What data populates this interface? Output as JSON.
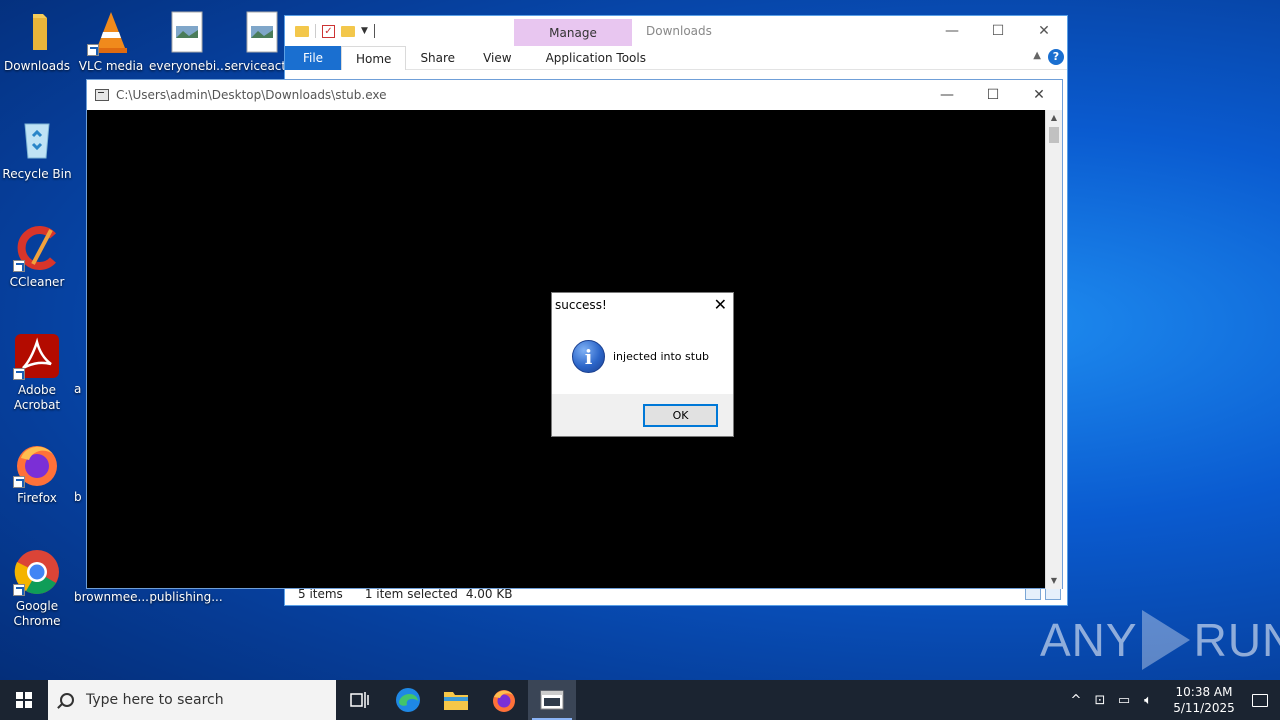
{
  "desktop": {
    "icons": [
      {
        "label": "Downloads"
      },
      {
        "label": "VLC media"
      },
      {
        "label": "everyonebi..."
      },
      {
        "label": "serviceact..."
      },
      {
        "label": "Recycle Bin"
      },
      {
        "label": "CCleaner"
      },
      {
        "label": "Adobe\nAcrobat"
      },
      {
        "label": "Firefox"
      },
      {
        "label": "Google\nChrome"
      },
      {
        "label": "brownmee..."
      },
      {
        "label": "publishing..."
      },
      {
        "label": "a"
      },
      {
        "label": "b"
      }
    ]
  },
  "explorer": {
    "title": "Downloads",
    "context_tab": "Manage",
    "tabs": {
      "file": "File",
      "home": "Home",
      "share": "Share",
      "view": "View",
      "app_tools": "Application Tools"
    },
    "status": {
      "items": "5 items",
      "selected": "1 item selected",
      "size": "4.00 KB"
    },
    "help": "?"
  },
  "console": {
    "title": "C:\\Users\\admin\\Desktop\\Downloads\\stub.exe"
  },
  "msgbox": {
    "title": "success!",
    "message": "injected into stub",
    "ok": "OK",
    "icon": "info-icon"
  },
  "watermark": {
    "left": "ANY",
    "right": "RUN"
  },
  "taskbar": {
    "search_placeholder": "Type here to search",
    "time": "10:38 AM",
    "date": "5/11/2025"
  },
  "window_controls": {
    "minimize": "—",
    "maximize": "☐",
    "close": "✕"
  }
}
